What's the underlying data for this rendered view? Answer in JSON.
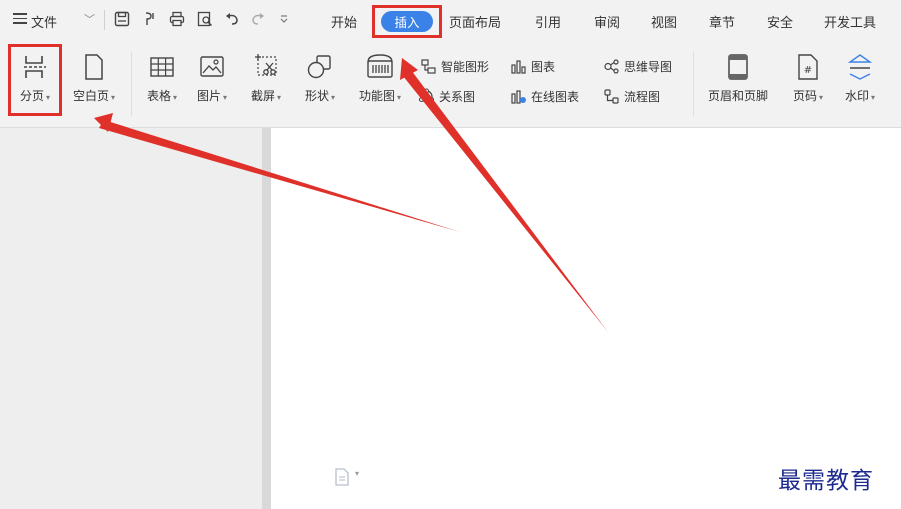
{
  "menubar": {
    "file": "文件",
    "tabs": [
      "开始",
      "插入",
      "页面布局",
      "引用",
      "审阅",
      "视图",
      "章节",
      "安全",
      "开发工具"
    ],
    "active_tab": "插入"
  },
  "ribbon": {
    "page_break": "分页",
    "blank_page": "空白页",
    "table": "表格",
    "picture": "图片",
    "screenshot": "截屏",
    "shape": "形状",
    "function_chart": "功能图",
    "smart_art": "智能图形",
    "chart": "图表",
    "mind_map": "思维导图",
    "relation_chart": "关系图",
    "online_chart": "在线图表",
    "flowchart": "流程图",
    "header_footer": "页眉和页脚",
    "page_number": "页码",
    "watermark": "水印"
  },
  "watermark_text": "最需教育",
  "colors": {
    "accent": "#3b82e8",
    "highlight": "#e0302a",
    "watermark": "#1d2a8f"
  }
}
